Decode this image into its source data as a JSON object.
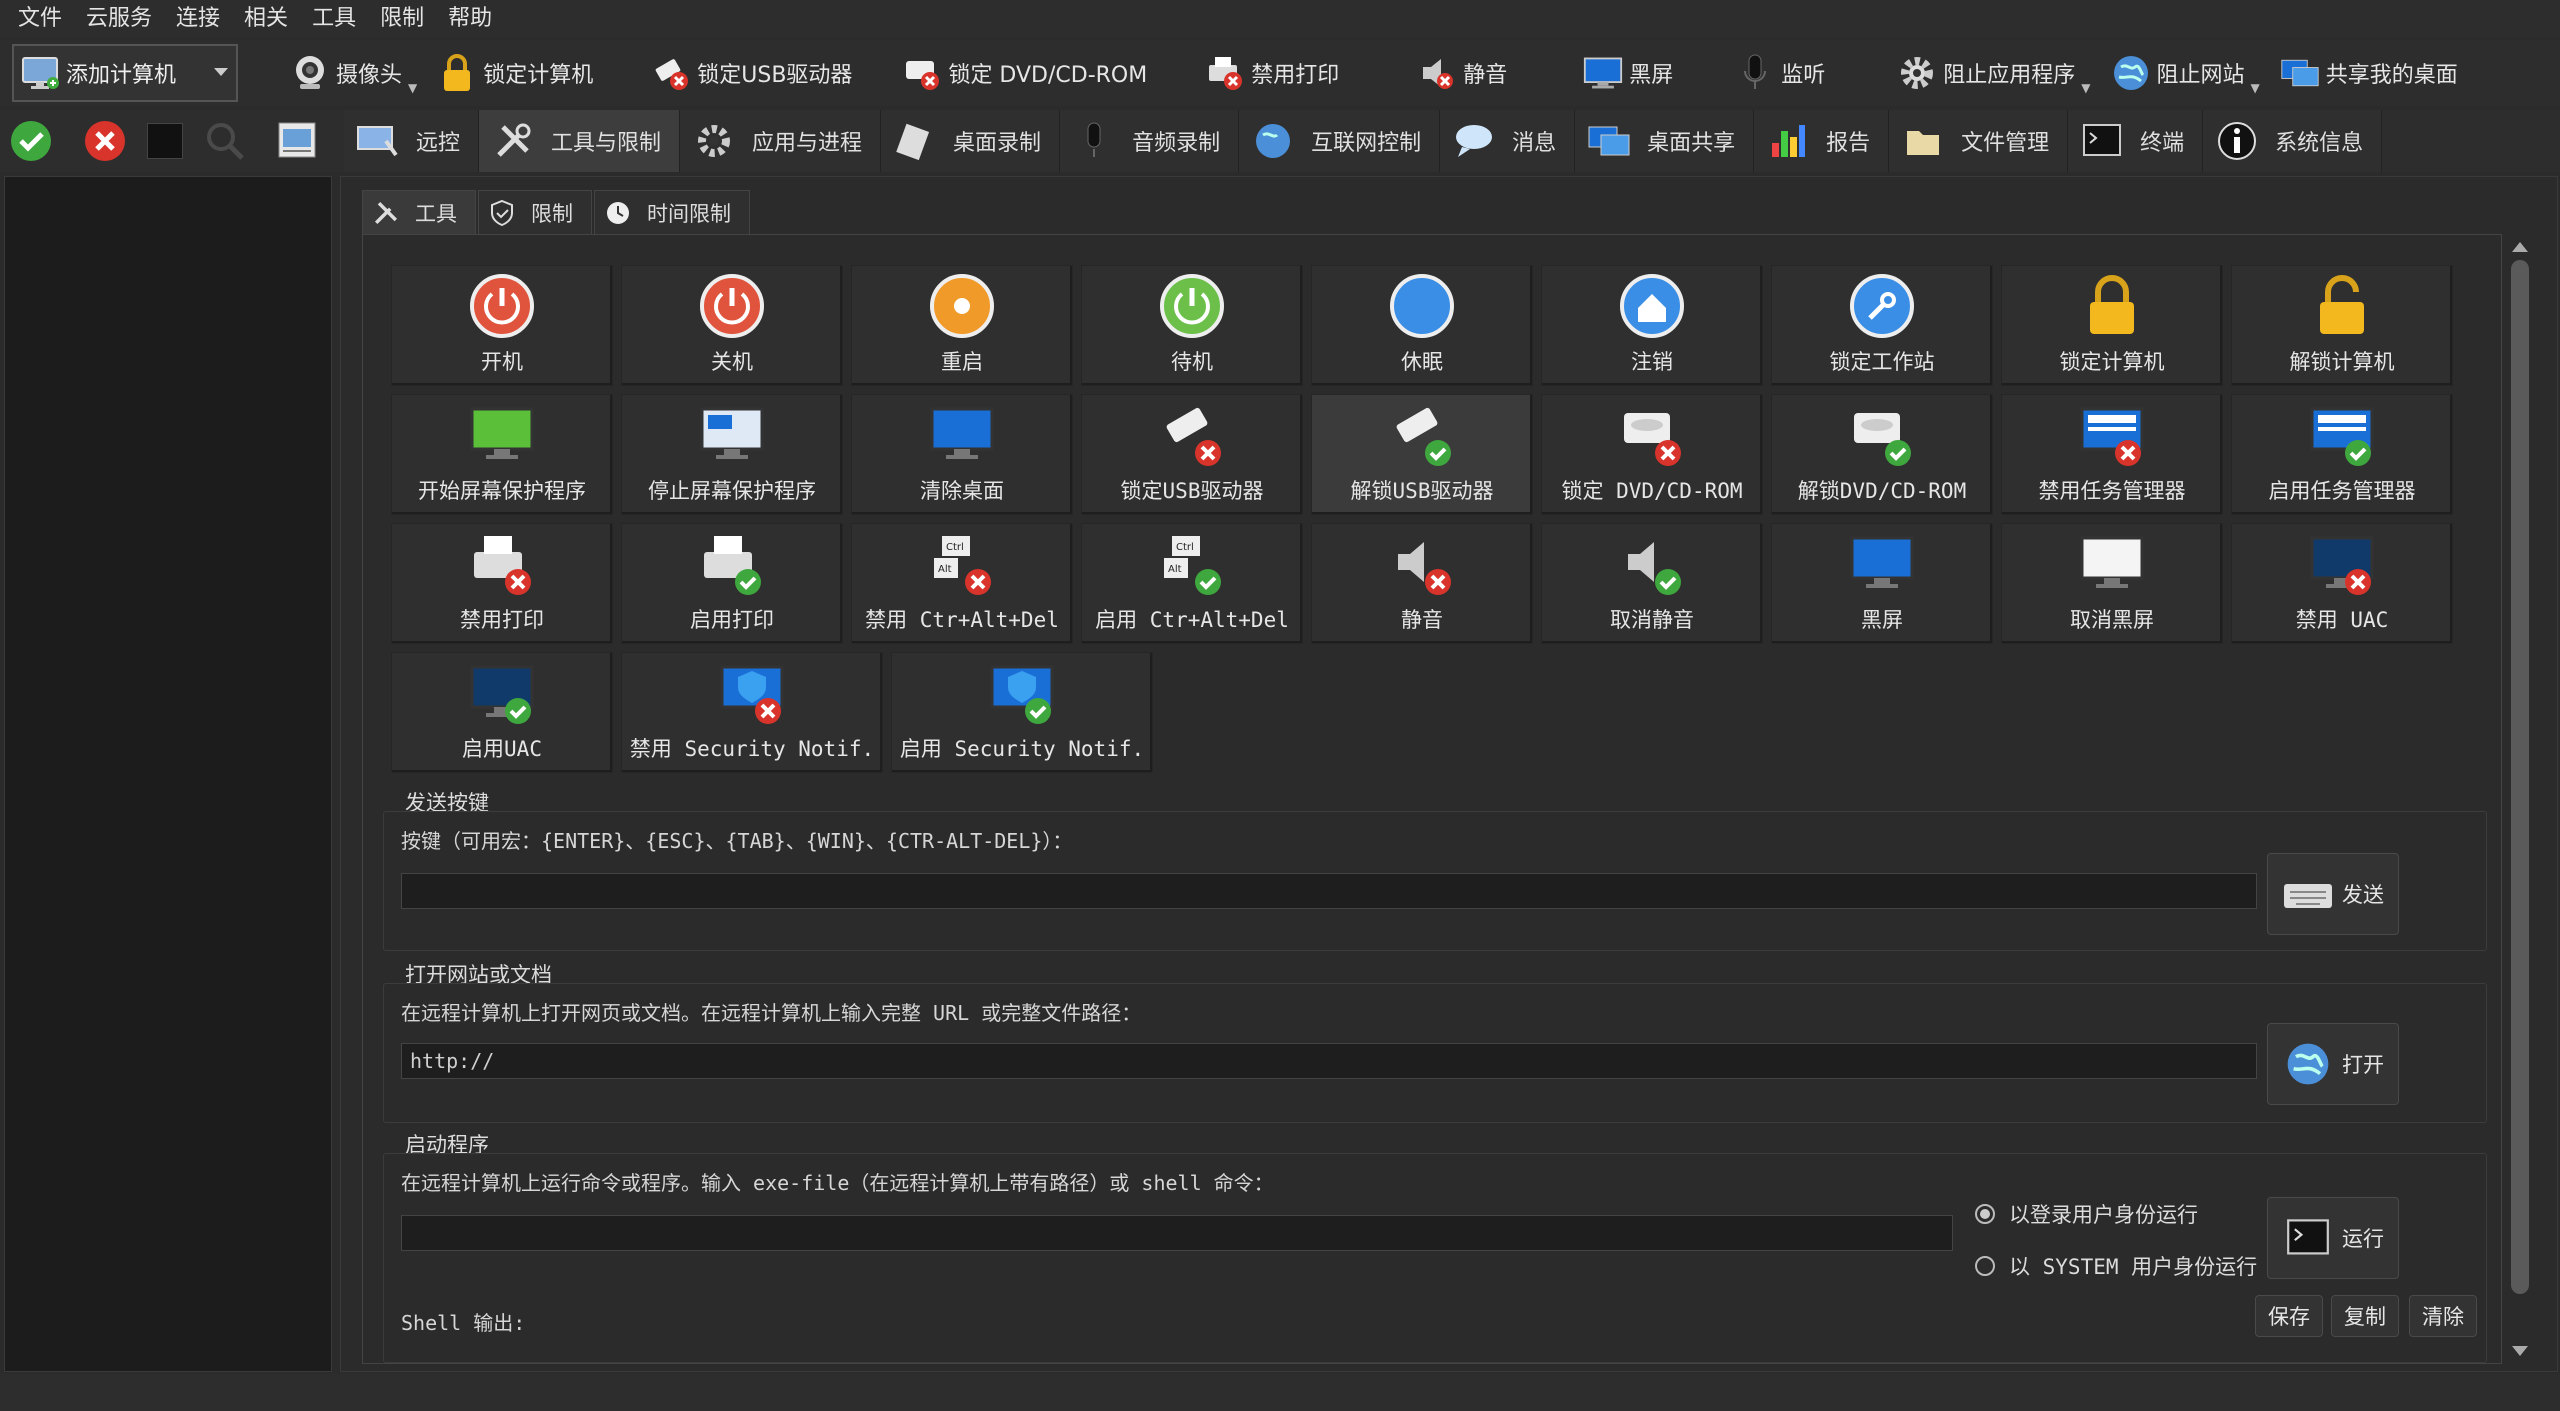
{
  "menu": [
    "文件",
    "云服务",
    "连接",
    "相关",
    "工具",
    "限制",
    "帮助"
  ],
  "toolbar": {
    "add_computer": "添加计算机",
    "items": [
      {
        "label": "摄像头",
        "icon": "webcam-icon",
        "dropdown": true
      },
      {
        "label": "锁定计算机",
        "icon": "lock-icon",
        "dropdown": false
      },
      {
        "label": "锁定USB驱动器",
        "icon": "usb-lock-icon",
        "dropdown": false
      },
      {
        "label": "锁定 DVD/CD-ROM",
        "icon": "dvd-lock-icon",
        "dropdown": false
      },
      {
        "label": "禁用打印",
        "icon": "printer-disable-icon",
        "dropdown": false
      },
      {
        "label": "静音",
        "icon": "mute-icon",
        "dropdown": false
      },
      {
        "label": "黑屏",
        "icon": "monitor-icon",
        "dropdown": false
      },
      {
        "label": "监听",
        "icon": "microphone-icon",
        "dropdown": false
      },
      {
        "label": "阻止应用程序",
        "icon": "gear-icon",
        "dropdown": true
      },
      {
        "label": "阻止网站",
        "icon": "globe-icon",
        "dropdown": true
      },
      {
        "label": "共享我的桌面",
        "icon": "share-desktop-icon",
        "dropdown": false
      }
    ]
  },
  "main_tabs": [
    {
      "label": "远控",
      "icon": "remote-control-icon"
    },
    {
      "label": "工具与限制",
      "icon": "tools-icon",
      "active": true
    },
    {
      "label": "应用与进程",
      "icon": "gear-icon"
    },
    {
      "label": "桌面录制",
      "icon": "film-icon"
    },
    {
      "label": "音频录制",
      "icon": "microphone-icon"
    },
    {
      "label": "互联网控制",
      "icon": "globe-icon"
    },
    {
      "label": "消息",
      "icon": "chat-bubble-icon"
    },
    {
      "label": "桌面共享",
      "icon": "share-desktop-icon"
    },
    {
      "label": "报告",
      "icon": "bar-chart-icon"
    },
    {
      "label": "文件管理",
      "icon": "folder-icon"
    },
    {
      "label": "终端",
      "icon": "terminal-icon"
    },
    {
      "label": "系统信息",
      "icon": "info-icon"
    }
  ],
  "sub_tabs": [
    {
      "label": "工具",
      "icon": "tools-icon",
      "active": true
    },
    {
      "label": "限制",
      "icon": "shield-icon"
    },
    {
      "label": "时间限制",
      "icon": "clock-icon"
    }
  ],
  "tools": [
    {
      "label": "开机",
      "icon": "power-on-icon"
    },
    {
      "label": "关机",
      "icon": "power-off-icon"
    },
    {
      "label": "重启",
      "icon": "restart-icon"
    },
    {
      "label": "待机",
      "icon": "standby-icon"
    },
    {
      "label": "休眠",
      "icon": "hibernate-icon"
    },
    {
      "label": "注销",
      "icon": "logoff-icon"
    },
    {
      "label": "锁定工作站",
      "icon": "lock-workstation-icon"
    },
    {
      "label": "锁定计算机",
      "icon": "lock-icon"
    },
    {
      "label": "解锁计算机",
      "icon": "unlock-icon"
    },
    {
      "label": "开始屏幕保护程序",
      "icon": "screensaver-start-icon"
    },
    {
      "label": "停止屏幕保护程序",
      "icon": "screensaver-stop-icon"
    },
    {
      "label": "清除桌面",
      "icon": "clear-desktop-icon"
    },
    {
      "label": "锁定USB驱动器",
      "icon": "usb-lock-icon"
    },
    {
      "label": "解锁USB驱动器",
      "icon": "usb-unlock-icon"
    },
    {
      "label": "锁定 DVD/CD-ROM",
      "icon": "dvd-lock-icon"
    },
    {
      "label": "解锁DVD/CD-ROM",
      "icon": "dvd-unlock-icon"
    },
    {
      "label": "禁用任务管理器",
      "icon": "taskmgr-disable-icon"
    },
    {
      "label": "启用任务管理器",
      "icon": "taskmgr-enable-icon"
    },
    {
      "label": "禁用打印",
      "icon": "printer-disable-icon"
    },
    {
      "label": "启用打印",
      "icon": "printer-enable-icon"
    },
    {
      "label": "禁用 Ctr+Alt+Del",
      "icon": "cad-disable-icon"
    },
    {
      "label": "启用 Ctr+Alt+Del",
      "icon": "cad-enable-icon"
    },
    {
      "label": "静音",
      "icon": "mute-icon"
    },
    {
      "label": "取消静音",
      "icon": "unmute-icon"
    },
    {
      "label": "黑屏",
      "icon": "blackscreen-icon"
    },
    {
      "label": "取消黑屏",
      "icon": "unblackscreen-icon"
    },
    {
      "label": "禁用 UAC",
      "icon": "uac-disable-icon"
    },
    {
      "label": "启用UAC",
      "icon": "uac-enable-icon"
    },
    {
      "label": "禁用 Security Notif.",
      "icon": "security-disable-icon"
    },
    {
      "label": "启用 Security Notif.",
      "icon": "security-enable-icon"
    }
  ],
  "send_keys": {
    "title": "发送按键",
    "label": "按键（可用宏：{ENTER}、{ESC}、{TAB}、{WIN}、{CTR-ALT-DEL}）：",
    "value": "",
    "button": "发送"
  },
  "open_url": {
    "title": "打开网站或文档",
    "label": "在远程计算机上打开网页或文档。在远程计算机上输入完整 URL 或完整文件路径：",
    "value": "http://",
    "button": "打开"
  },
  "run_program": {
    "title": "启动程序",
    "label": "在远程计算机上运行命令或程序。输入 exe-file（在远程计算机上带有路径）或 shell 命令：",
    "value": "",
    "option_user": "以登录用户身份运行",
    "option_system": "以 SYSTEM 用户身份运行",
    "selected": "option_user",
    "button": "运行",
    "shell_output": "Shell 输出:",
    "save": "保存",
    "copy": "复制",
    "clear": "清除"
  }
}
